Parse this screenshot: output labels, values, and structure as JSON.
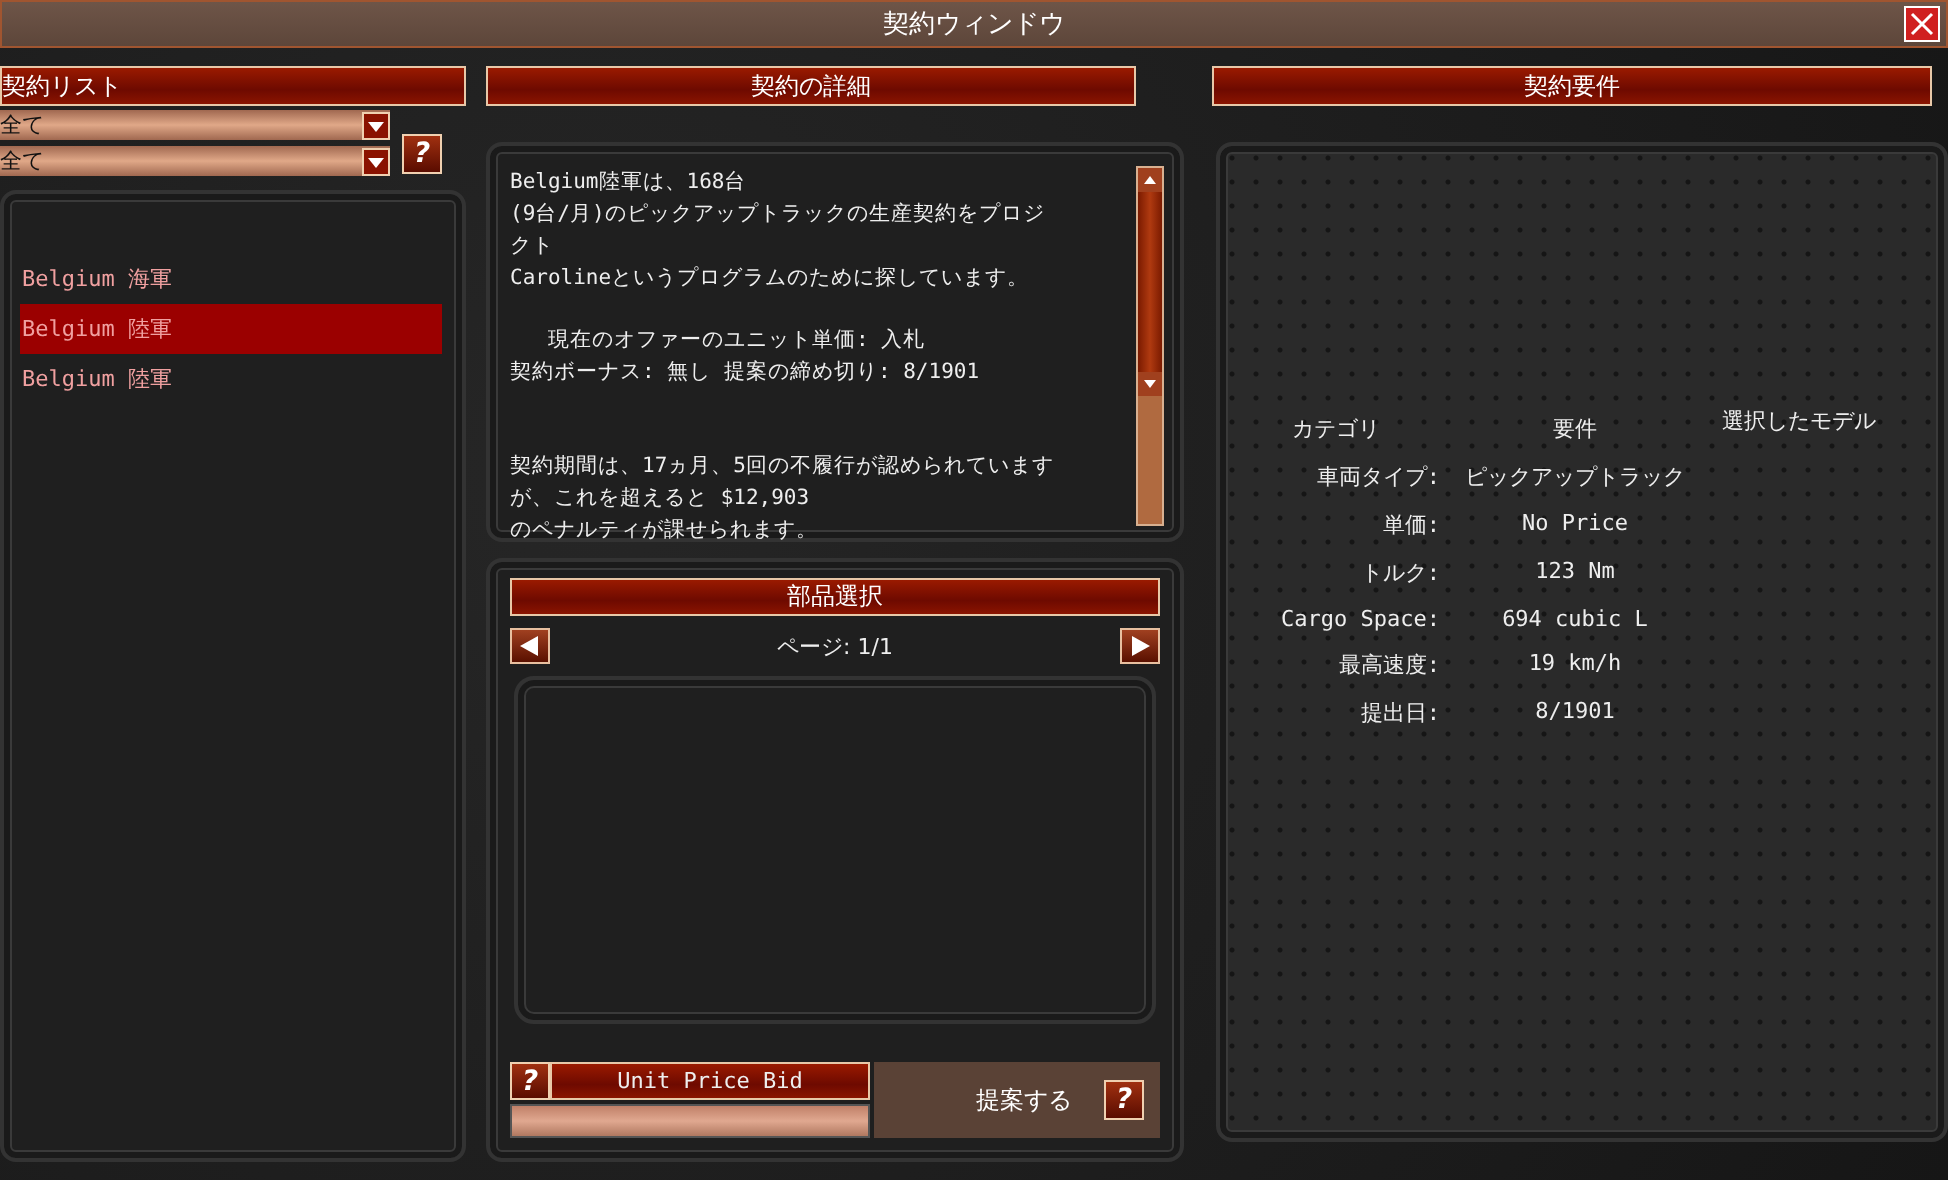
{
  "window": {
    "title": "契約ウィンドウ"
  },
  "contract_list": {
    "header": "契約リスト",
    "filters": [
      {
        "value": "全て"
      },
      {
        "value": "全て"
      }
    ],
    "help": "?",
    "items": [
      {
        "label": "Belgium 海軍",
        "selected": false
      },
      {
        "label": "Belgium 陸軍",
        "selected": true
      },
      {
        "label": "Belgium 陸軍",
        "selected": false
      }
    ]
  },
  "details": {
    "header": "契約の詳細",
    "paragraphs": [
      [
        "Belgium陸軍は、168台",
        "(9台/月)のピックアップトラックの生産契約をプロジ",
        "クト",
        "Carolineというプログラムのために探しています。"
      ],
      [
        "   現在のオファーのユニット単価: 入札",
        "契約ボーナス: 無し 提案の締め切り: 8/1901"
      ],
      [
        "契約期間は、17ヵ月、5回の不履行が認められています",
        "が、これを超えると $12,903",
        "のペナルティが課せられます。"
      ]
    ]
  },
  "parts": {
    "header": "部品選択",
    "page": "ページ: 1/1"
  },
  "bid": {
    "help": "?",
    "label": "Unit Price Bid",
    "submit": "提案する",
    "submit_help": "?"
  },
  "requirements": {
    "header": "契約要件",
    "columns": [
      "カテゴリ",
      "要件",
      "選択したモデル"
    ],
    "rows": [
      {
        "label": "車両タイプ:",
        "value": "ピックアップトラック"
      },
      {
        "label": "単価:",
        "value": "No Price"
      },
      {
        "label": "トルク:",
        "value": "123 Nm"
      },
      {
        "label": "Cargo Space:",
        "value": "694 cubic L"
      },
      {
        "label": "最高速度:",
        "value": "19 km/h"
      },
      {
        "label": "提出日:",
        "value": "8/1901"
      }
    ]
  }
}
